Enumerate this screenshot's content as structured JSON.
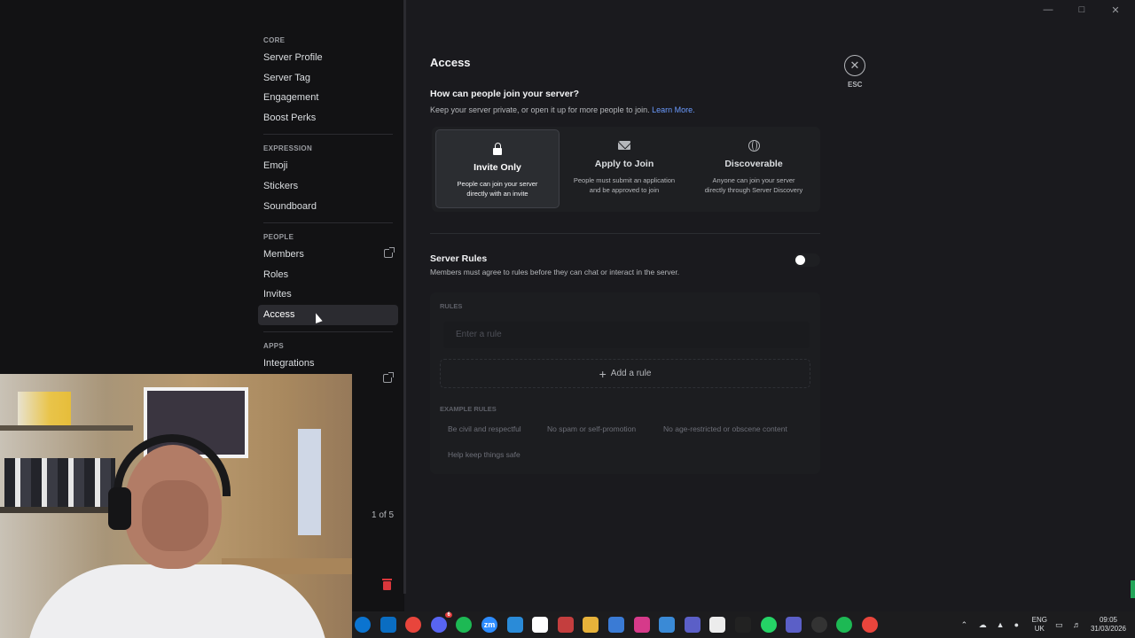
{
  "nav": {
    "sections": [
      {
        "header": "CORE",
        "items": [
          "Server Profile",
          "Server Tag",
          "Engagement",
          "Boost Perks"
        ]
      },
      {
        "header": "EXPRESSION",
        "items": [
          "Emoji",
          "Stickers",
          "Soundboard"
        ]
      },
      {
        "header": "PEOPLE",
        "items": [
          "Members",
          "Roles",
          "Invites",
          "Access"
        ]
      },
      {
        "header": "APPS",
        "items": [
          "Integrations"
        ]
      }
    ],
    "active_item": "Access",
    "pager_text": "1 of 5"
  },
  "page": {
    "title": "Access",
    "esc_label": "ESC",
    "join": {
      "question": "How can people join your server?",
      "description": "Keep your server private, or open it up for more people to join.",
      "learn_more": "Learn More.",
      "options": [
        {
          "icon": "lock-icon",
          "label": "Invite Only",
          "desc": "People can join your server directly with an invite",
          "selected": true
        },
        {
          "icon": "envelope-icon",
          "label": "Apply to Join",
          "desc": "People must submit an application and be approved to join",
          "selected": false
        },
        {
          "icon": "globe-icon",
          "label": "Discoverable",
          "desc": "Anyone can join your server directly through Server Discovery",
          "selected": false
        }
      ]
    },
    "rules": {
      "title": "Server Rules",
      "description": "Members must agree to rules before they can chat or interact in the server.",
      "enabled": false,
      "rules_header": "RULES",
      "input_placeholder": "Enter a rule",
      "add_rule": "Add a rule",
      "examples_header": "EXAMPLE RULES",
      "examples": [
        "Be civil and respectful",
        "No spam or self-promotion",
        "No age-restricted or obscene content",
        "Help keep things safe"
      ]
    }
  },
  "taskbar": {
    "apps": [
      {
        "name": "discord-icon",
        "color": "#5865f2",
        "badge": "6"
      },
      {
        "name": "spotify-icon",
        "color": "#1db954"
      },
      {
        "name": "zoom-icon",
        "color": "#2d8cff",
        "text": "zm"
      },
      {
        "name": "vscode-icon",
        "color": "#2a8bd8"
      },
      {
        "name": "capcut-icon",
        "color": "#ffffff"
      }
    ],
    "tray": {
      "lang_top": "ENG",
      "lang_bottom": "UK",
      "time": "09:05",
      "date": "31/03/2026"
    }
  }
}
